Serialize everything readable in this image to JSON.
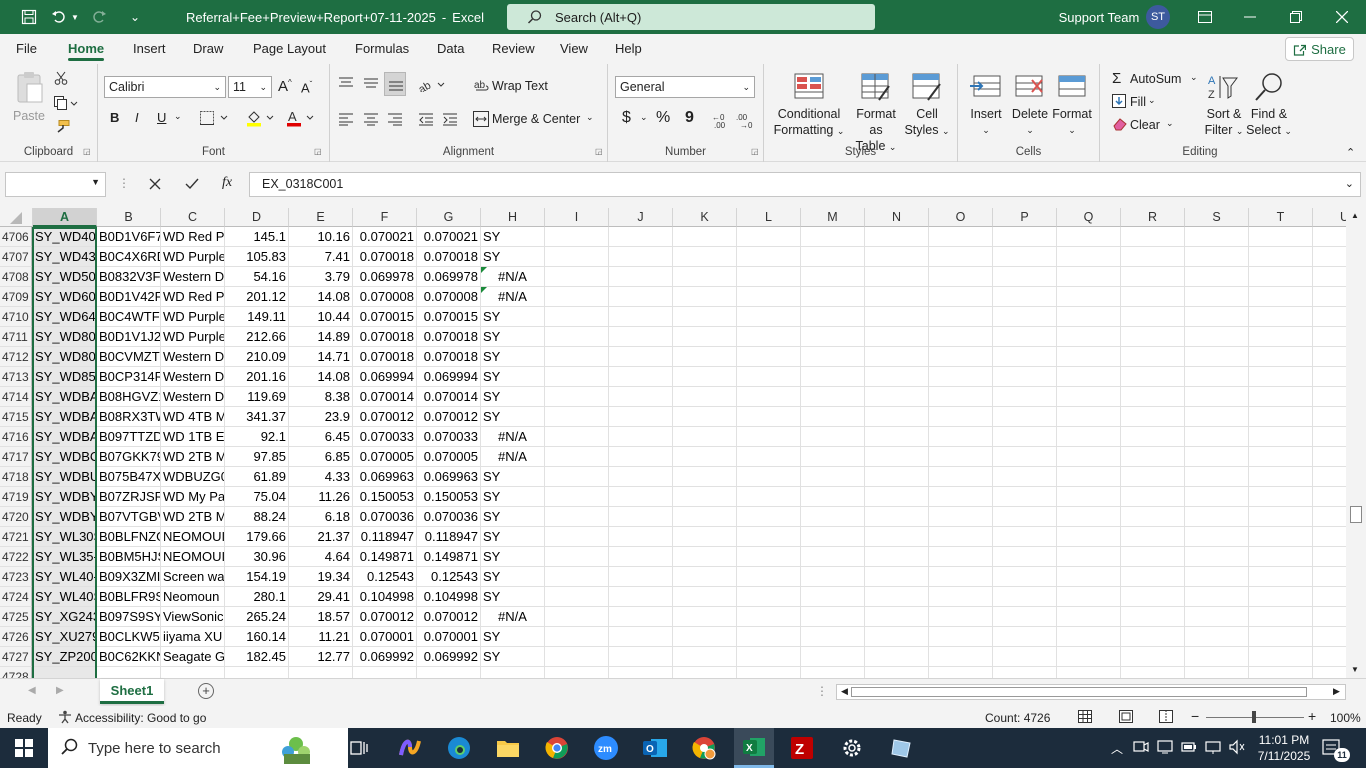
{
  "title": {
    "doc_name": "Referral+Fee+Preview+Report+07-11-2025",
    "separator": "-",
    "app": "Excel",
    "search_placeholder": "Search (Alt+Q)",
    "user_name": "Support Team",
    "user_initials": "ST"
  },
  "tabs": [
    "File",
    "Home",
    "Insert",
    "Draw",
    "Page Layout",
    "Formulas",
    "Data",
    "Review",
    "View",
    "Help"
  ],
  "share_label": "Share",
  "ribbon": {
    "clipboard": {
      "paste": "Paste",
      "group": "Clipboard"
    },
    "font": {
      "name": "Calibri",
      "size": "11",
      "bold": "B",
      "italic": "I",
      "underline": "U",
      "group": "Font"
    },
    "alignment": {
      "wrap": "Wrap Text",
      "merge": "Merge & Center",
      "group": "Alignment"
    },
    "number": {
      "format": "General",
      "currency": "$",
      "percent": "%",
      "comma": "9",
      "group": "Number"
    },
    "styles": {
      "conditional1": "Conditional",
      "conditional2": "Formatting",
      "table1": "Format as",
      "table2": "Table",
      "cell1": "Cell",
      "cell2": "Styles",
      "group": "Styles"
    },
    "cells": {
      "insert": "Insert",
      "delete": "Delete",
      "format": "Format",
      "group": "Cells"
    },
    "editing": {
      "autosum": "AutoSum",
      "fill": "Fill",
      "clear": "Clear",
      "sort1": "Sort &",
      "sort2": "Filter",
      "find1": "Find &",
      "find2": "Select",
      "group": "Editing"
    }
  },
  "formula_bar": {
    "name_box": "",
    "fx": "fx",
    "value": "EX_0318C001"
  },
  "columns": [
    "A",
    "B",
    "C",
    "D",
    "E",
    "F",
    "G",
    "H",
    "I",
    "J",
    "K",
    "L",
    "M",
    "N",
    "O",
    "P",
    "Q",
    "R",
    "S",
    "T",
    "U"
  ],
  "rows": [
    {
      "n": "4706",
      "a": "SY_WD40(",
      "b": "B0D1V6F7",
      "c": "WD Red P",
      "d": "145.1",
      "e": "10.16",
      "f": "0.070021",
      "g": "0.070021",
      "h": "SY",
      "na": false
    },
    {
      "n": "4707",
      "a": "SY_WD43I",
      "b": "B0C4X6RD",
      "c": "WD Purple",
      "d": "105.83",
      "e": "7.41",
      "f": "0.070018",
      "g": "0.070018",
      "h": "SY",
      "na": false
    },
    {
      "n": "4708",
      "a": "SY_WD50(",
      "b": "B0832V3FI",
      "c": "Western D",
      "d": "54.16",
      "e": "3.79",
      "f": "0.069978",
      "g": "0.069978",
      "h": "#N/A",
      "na": true,
      "tri": true
    },
    {
      "n": "4709",
      "a": "SY_WD60(",
      "b": "B0D1V42F",
      "c": "WD Red P",
      "d": "201.12",
      "e": "14.08",
      "f": "0.070008",
      "g": "0.070008",
      "h": "#N/A",
      "na": true,
      "tri": true
    },
    {
      "n": "4710",
      "a": "SY_WD64I",
      "b": "B0C4WTF5",
      "c": "WD Purple",
      "d": "149.11",
      "e": "10.44",
      "f": "0.070015",
      "g": "0.070015",
      "h": "SY",
      "na": false
    },
    {
      "n": "4711",
      "a": "SY_WD80(",
      "b": "B0D1V1J2I",
      "c": "WD Purple",
      "d": "212.66",
      "e": "14.89",
      "f": "0.070018",
      "g": "0.070018",
      "h": "SY",
      "na": false
    },
    {
      "n": "4712",
      "a": "SY_WD80(",
      "b": "B0CVMZTI",
      "c": "Western D",
      "d": "210.09",
      "e": "14.71",
      "f": "0.070018",
      "g": "0.070018",
      "h": "SY",
      "na": false
    },
    {
      "n": "4713",
      "a": "SY_WD85I",
      "b": "B0CP314R",
      "c": "Western D",
      "d": "201.16",
      "e": "14.08",
      "f": "0.069994",
      "g": "0.069994",
      "h": "SY",
      "na": false
    },
    {
      "n": "4714",
      "a": "SY_WDBA",
      "b": "B08HGVZ1",
      "c": "Western D",
      "d": "119.69",
      "e": "8.38",
      "f": "0.070014",
      "g": "0.070014",
      "h": "SY",
      "na": false
    },
    {
      "n": "4715",
      "a": "SY_WDBA",
      "b": "B08RX3TW",
      "c": "WD 4TB M",
      "d": "341.37",
      "e": "23.9",
      "f": "0.070012",
      "g": "0.070012",
      "h": "SY",
      "na": false
    },
    {
      "n": "4716",
      "a": "SY_WDBA",
      "b": "B097TTZD",
      "c": "WD 1TB El",
      "d": "92.1",
      "e": "6.45",
      "f": "0.070033",
      "g": "0.070033",
      "h": "#N/A",
      "na": true
    },
    {
      "n": "4717",
      "a": "SY_WDBC",
      "b": "B07GKK79",
      "c": "WD 2TB M",
      "d": "97.85",
      "e": "6.85",
      "f": "0.070005",
      "g": "0.070005",
      "h": "#N/A",
      "na": true
    },
    {
      "n": "4718",
      "a": "SY_WDBU",
      "b": "B075B47X!",
      "c": "WDBUZG0",
      "d": "61.89",
      "e": "4.33",
      "f": "0.069963",
      "g": "0.069963",
      "h": "SY",
      "na": false
    },
    {
      "n": "4719",
      "a": "SY_WDBY'",
      "b": "B07ZRJSRI",
      "c": "WD My Pa",
      "d": "75.04",
      "e": "11.26",
      "f": "0.150053",
      "g": "0.150053",
      "h": "SY",
      "na": false
    },
    {
      "n": "4720",
      "a": "SY_WDBY'",
      "b": "B07VTGBV",
      "c": "WD 2TB M",
      "d": "88.24",
      "e": "6.18",
      "f": "0.070036",
      "g": "0.070036",
      "h": "SY",
      "na": false
    },
    {
      "n": "4721",
      "a": "SY_WL30S",
      "b": "B0BLFNZG",
      "c": "NEOMOUI",
      "d": "179.66",
      "e": "21.37",
      "f": "0.118947",
      "g": "0.118947",
      "h": "SY",
      "na": false
    },
    {
      "n": "4722",
      "a": "SY_WL35-",
      "b": "B0BM5HJS",
      "c": "NEOMOUI",
      "d": "30.96",
      "e": "4.64",
      "f": "0.149871",
      "g": "0.149871",
      "h": "SY",
      "na": false
    },
    {
      "n": "4723",
      "a": "SY_WL40-",
      "b": "B09X3ZMI",
      "c": "Screen wa",
      "d": "154.19",
      "e": "19.34",
      "f": "0.12543",
      "g": "0.12543",
      "h": "SY",
      "na": false
    },
    {
      "n": "4724",
      "a": "SY_WL40S",
      "b": "B0BLFR9S",
      "c": "Neomoun",
      "d": "280.1",
      "e": "29.41",
      "f": "0.104998",
      "g": "0.104998",
      "h": "SY",
      "na": false
    },
    {
      "n": "4725",
      "a": "SY_XG243",
      "b": "B097S9SYI",
      "c": "ViewSonic",
      "d": "265.24",
      "e": "18.57",
      "f": "0.070012",
      "g": "0.070012",
      "h": "#N/A",
      "na": true
    },
    {
      "n": "4726",
      "a": "SY_XU279",
      "b": "B0CLKW5J",
      "c": "iiyama XU",
      "d": "160.14",
      "e": "11.21",
      "f": "0.070001",
      "g": "0.070001",
      "h": "SY",
      "na": false
    },
    {
      "n": "4727",
      "a": "SY_ZP200(",
      "b": "B0C62KKN",
      "c": "Seagate G",
      "d": "182.45",
      "e": "12.77",
      "f": "0.069992",
      "g": "0.069992",
      "h": "SY",
      "na": false
    },
    {
      "n": "4728",
      "a": "",
      "b": "",
      "c": "",
      "d": "",
      "e": "",
      "f": "",
      "g": "",
      "h": "",
      "na": false
    }
  ],
  "sheet_tab": "Sheet1",
  "status": {
    "ready": "Ready",
    "accessibility": "Accessibility: Good to go",
    "count": "Count: 4726",
    "zoom": "100%"
  },
  "taskbar": {
    "search_placeholder": "Type here to search",
    "time": "11:01 PM",
    "date": "7/11/2025",
    "notif": "11"
  },
  "colors": {
    "excel_green": "#1e6e42",
    "taskbar": "#1c2c3c"
  }
}
